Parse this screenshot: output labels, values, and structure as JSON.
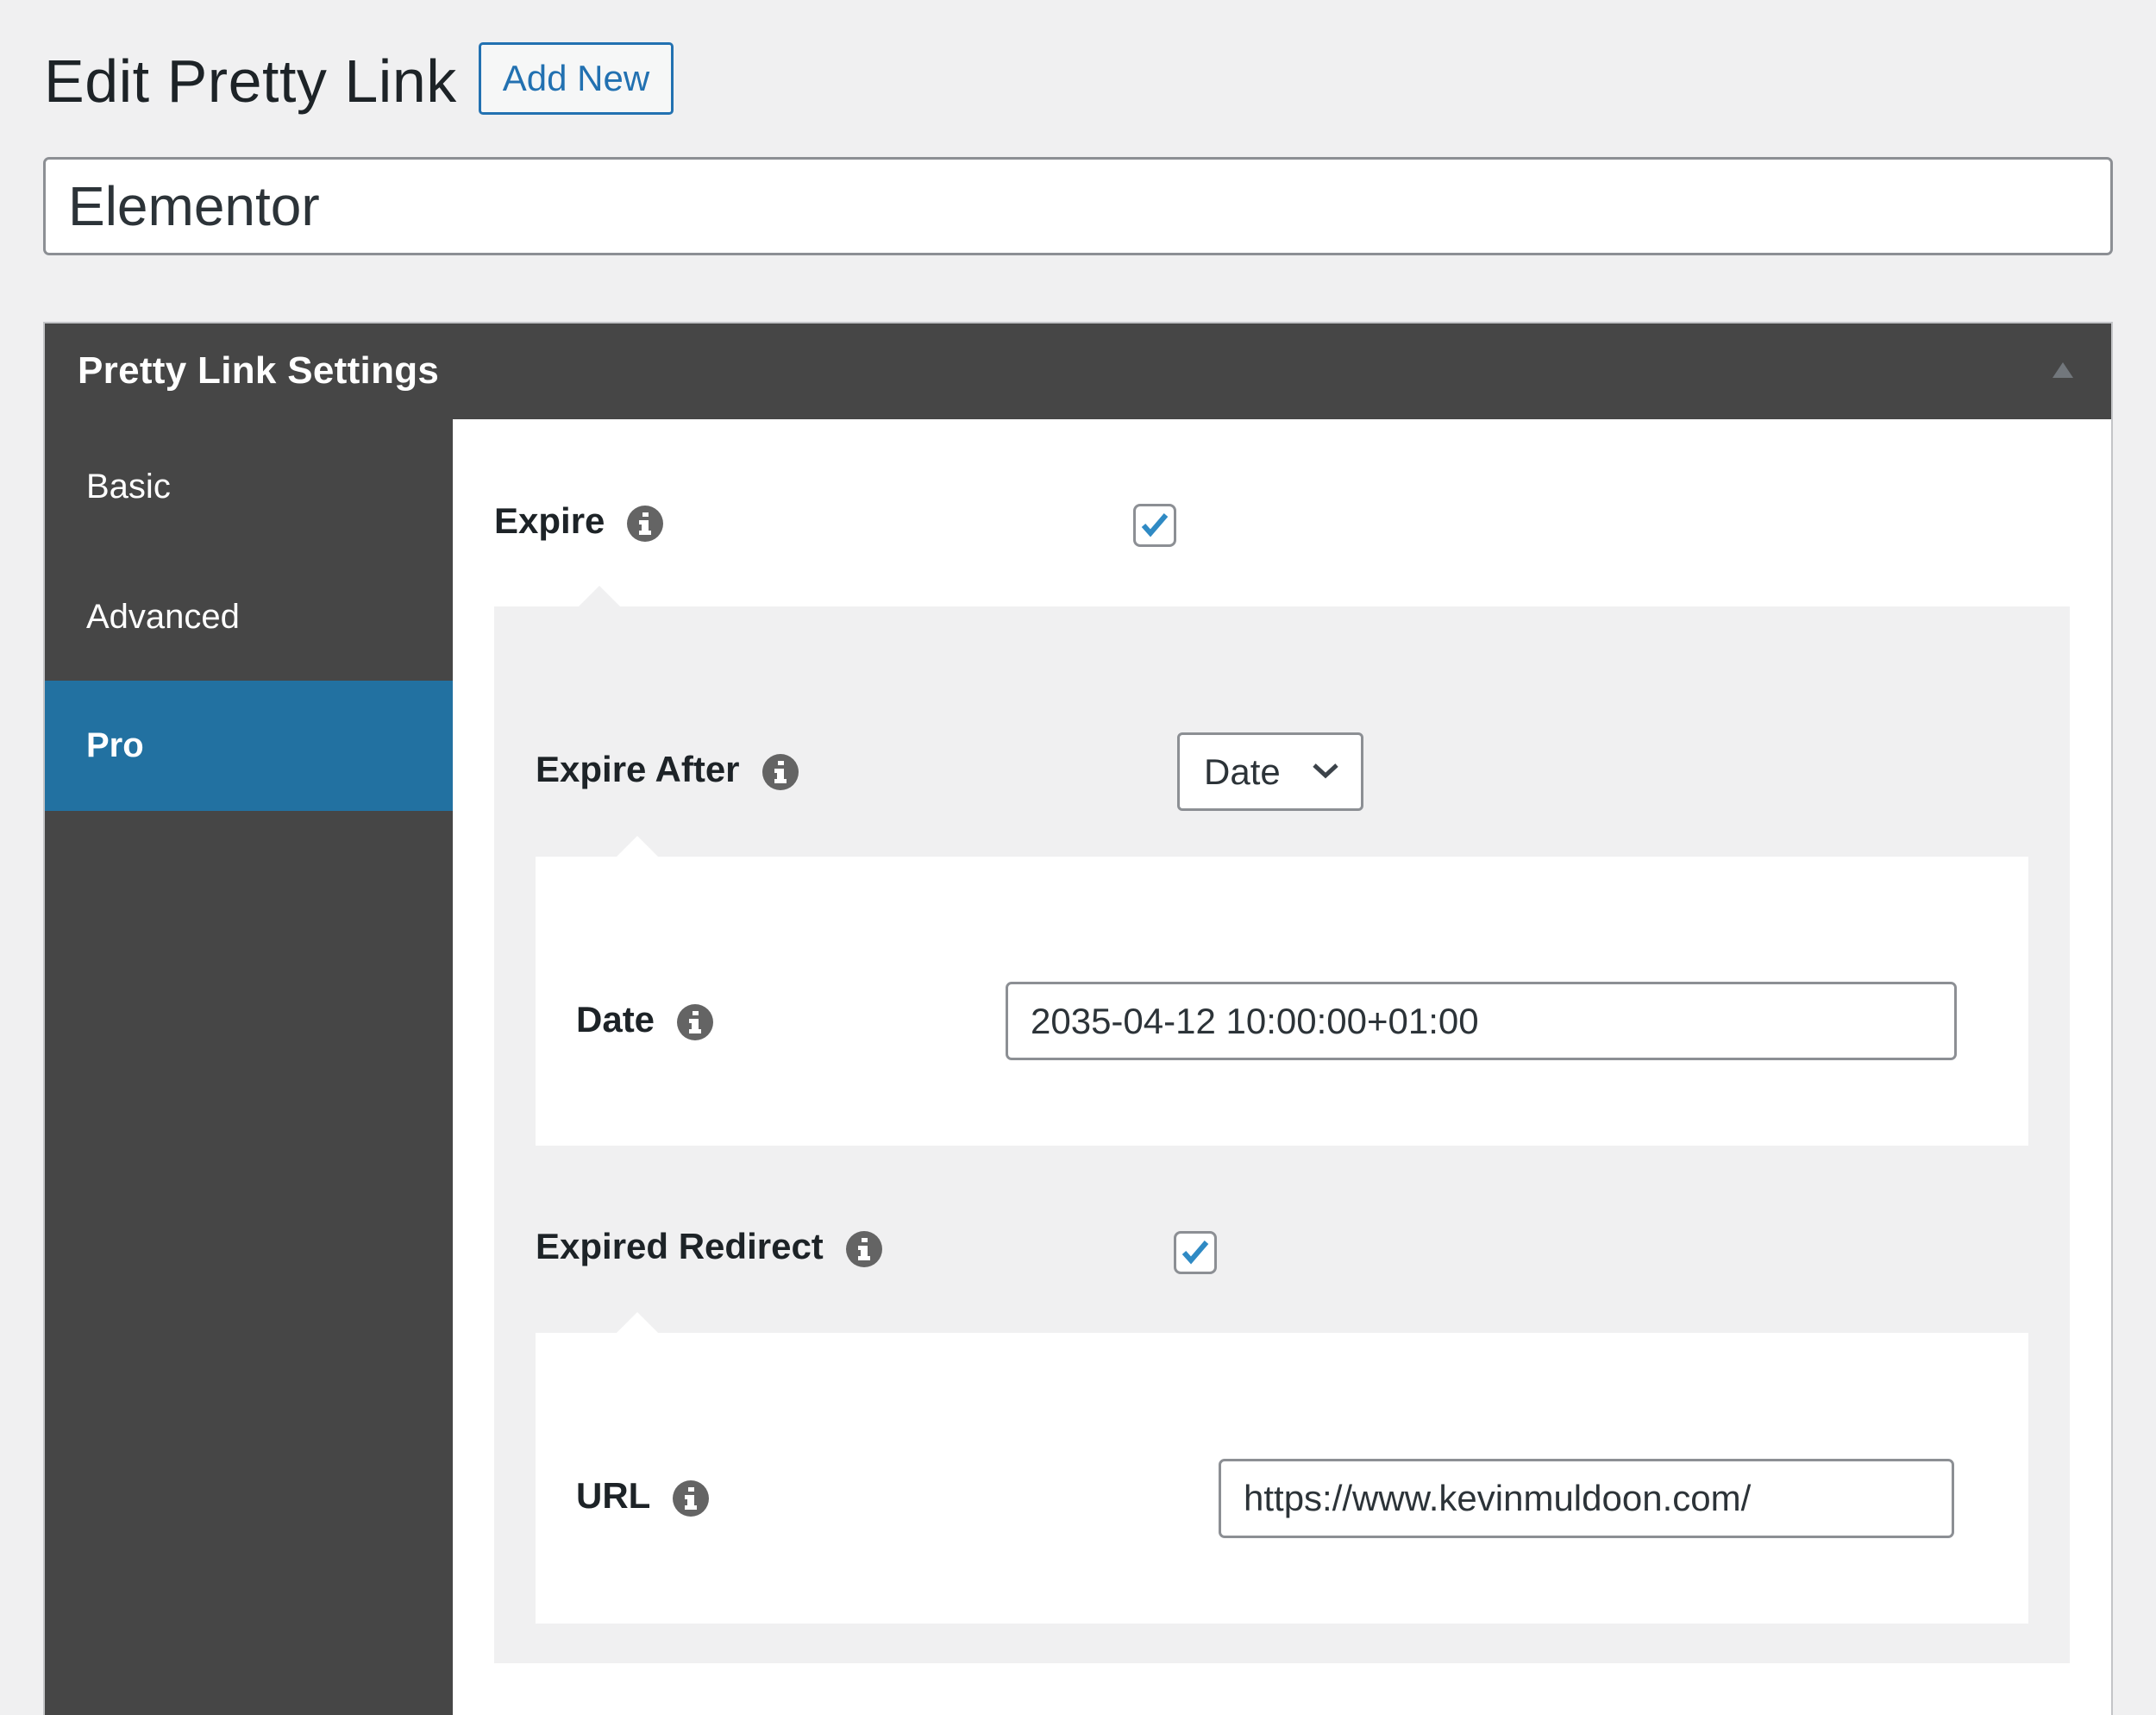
{
  "header": {
    "title": "Edit Pretty Link",
    "add_new_label": "Add New"
  },
  "link_title": {
    "value": "Elementor"
  },
  "settings": {
    "title": "Pretty Link Settings",
    "collapse_icon": "triangle-up-icon",
    "tabs": [
      {
        "label": "Basic",
        "active": false
      },
      {
        "label": "Advanced",
        "active": false
      },
      {
        "label": "Pro",
        "active": true
      }
    ],
    "fields": {
      "expire": {
        "label": "Expire",
        "checked": true,
        "icon": "info-icon"
      },
      "expire_after": {
        "label": "Expire After",
        "selected": "Date",
        "icon": "info-icon"
      },
      "date": {
        "label": "Date",
        "value": "2035-04-12 10:00:00+01:00",
        "icon": "info-icon"
      },
      "expired_redirect": {
        "label": "Expired Redirect",
        "checked": true,
        "icon": "info-icon"
      },
      "url": {
        "label": "URL",
        "value": "https://www.kevinmuldoon.com/",
        "icon": "info-icon"
      }
    }
  },
  "colors": {
    "accent": "#2271b1",
    "active_tab": "#2271a1",
    "dark_panel": "#464646",
    "page_bg": "#f0f0f1",
    "check": "#2f8ac4"
  }
}
